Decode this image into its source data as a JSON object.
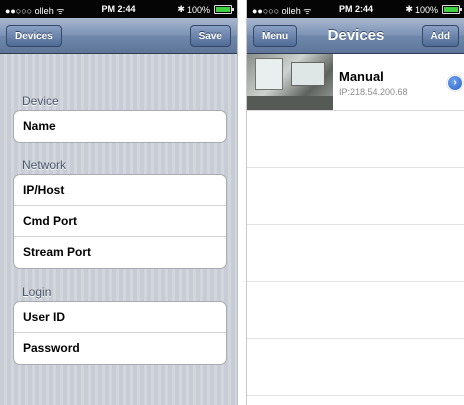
{
  "left_screen": {
    "status": {
      "carrier": "●●○○○ olleh ᯤ",
      "time": "PM 2:44",
      "battery": "100%"
    },
    "nav": {
      "back_label": "Devices",
      "save_label": "Save"
    },
    "sections": [
      {
        "title": "Device",
        "rows": [
          "Name"
        ]
      },
      {
        "title": "Network",
        "rows": [
          "IP/Host",
          "Cmd Port",
          "Stream Port"
        ]
      },
      {
        "title": "Login",
        "rows": [
          "User ID",
          "Password"
        ]
      }
    ]
  },
  "right_screen": {
    "status": {
      "carrier": "●●○○○ olleh ᯤ",
      "time": "PM 2:44",
      "battery": "100%"
    },
    "nav": {
      "menu_label": "Menu",
      "title": "Devices",
      "add_label": "Add"
    },
    "devices": [
      {
        "name": "Manual",
        "ip": "IP:218.54.200.68",
        "accessory_icon": "chevron-right-circle-icon"
      }
    ]
  },
  "colors": {
    "nav_bar": "#6e87ab",
    "accent_blue": "#2b63c8",
    "battery_green": "#3fd13f"
  }
}
